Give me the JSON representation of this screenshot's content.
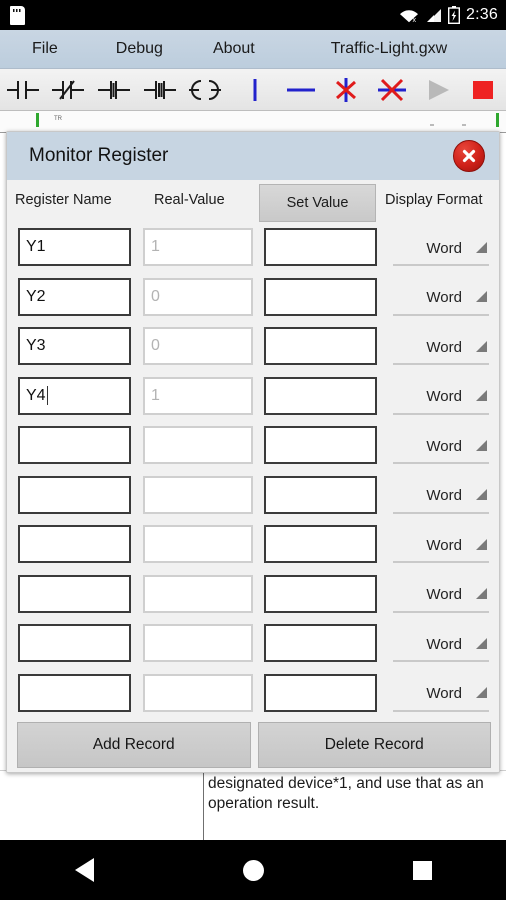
{
  "status_bar": {
    "left_icon": "sd-card-icon",
    "icons": [
      "wifi-off-icon",
      "signal-icon",
      "battery-charging-icon"
    ],
    "time": "2:36"
  },
  "menu_bar": {
    "items": [
      {
        "label": "File",
        "name": "menu-file"
      },
      {
        "label": "Debug",
        "name": "menu-debug"
      },
      {
        "label": "About",
        "name": "menu-about"
      }
    ],
    "document_title": "Traffic-Light.gxw"
  },
  "toolbar": {
    "buttons": [
      {
        "name": "contact-no-icon",
        "title": "Normally Open Contact"
      },
      {
        "name": "contact-nc-icon",
        "title": "Normally Closed Contact"
      },
      {
        "name": "contact-rising-icon",
        "title": "Rising Edge Contact"
      },
      {
        "name": "contact-falling-icon",
        "title": "Falling Edge Contact"
      },
      {
        "name": "coil-icon",
        "title": "Output Coil"
      },
      {
        "name": "vertical-line-icon",
        "title": "Vertical Link"
      },
      {
        "name": "horizontal-line-icon",
        "title": "Horizontal Link"
      },
      {
        "name": "delete-vertical-icon",
        "title": "Delete Vertical Link"
      },
      {
        "name": "delete-link-icon",
        "title": "Delete Link"
      },
      {
        "name": "run-icon",
        "title": "Run"
      },
      {
        "name": "stop-icon",
        "title": "Stop"
      }
    ],
    "accent_blue": "#2222cc",
    "accent_red": "#e01b1b",
    "stop_red": "#ee2222",
    "run_gray": "#b9b9b9"
  },
  "ladder_strip": {
    "rail_color": "#2fa82f",
    "rung_label": "TR"
  },
  "dialog": {
    "title": "Monitor Register",
    "close_icon": "close-icon",
    "columns": {
      "register_name": "Register Name",
      "real_value": "Real-Value",
      "set_value": "Set Value",
      "display_format": "Display Format"
    },
    "rows": [
      {
        "register_name": "Y1",
        "real_value": "1",
        "set_value": "",
        "display_format": "Word",
        "editing": false
      },
      {
        "register_name": "Y2",
        "real_value": "0",
        "set_value": "",
        "display_format": "Word",
        "editing": false
      },
      {
        "register_name": "Y3",
        "real_value": "0",
        "set_value": "",
        "display_format": "Word",
        "editing": false
      },
      {
        "register_name": "Y4",
        "real_value": "1",
        "set_value": "",
        "display_format": "Word",
        "editing": true
      },
      {
        "register_name": "",
        "real_value": "",
        "set_value": "",
        "display_format": "Word",
        "editing": false
      },
      {
        "register_name": "",
        "real_value": "",
        "set_value": "",
        "display_format": "Word",
        "editing": false
      },
      {
        "register_name": "",
        "real_value": "",
        "set_value": "",
        "display_format": "Word",
        "editing": false
      },
      {
        "register_name": "",
        "real_value": "",
        "set_value": "",
        "display_format": "Word",
        "editing": false
      },
      {
        "register_name": "",
        "real_value": "",
        "set_value": "",
        "display_format": "Word",
        "editing": false
      },
      {
        "register_name": "",
        "real_value": "",
        "set_value": "",
        "display_format": "Word",
        "editing": false
      }
    ],
    "actions": {
      "add_record": "Add Record",
      "delete_record": "Delete Record"
    },
    "header_color": "#c7d5e2",
    "body_color": "#f1f1f1"
  },
  "background_document": {
    "text": "designated device*1, and use that as an operation result."
  },
  "nav_bar": {
    "back": "back-icon",
    "home": "home-icon",
    "recents": "recents-icon"
  }
}
